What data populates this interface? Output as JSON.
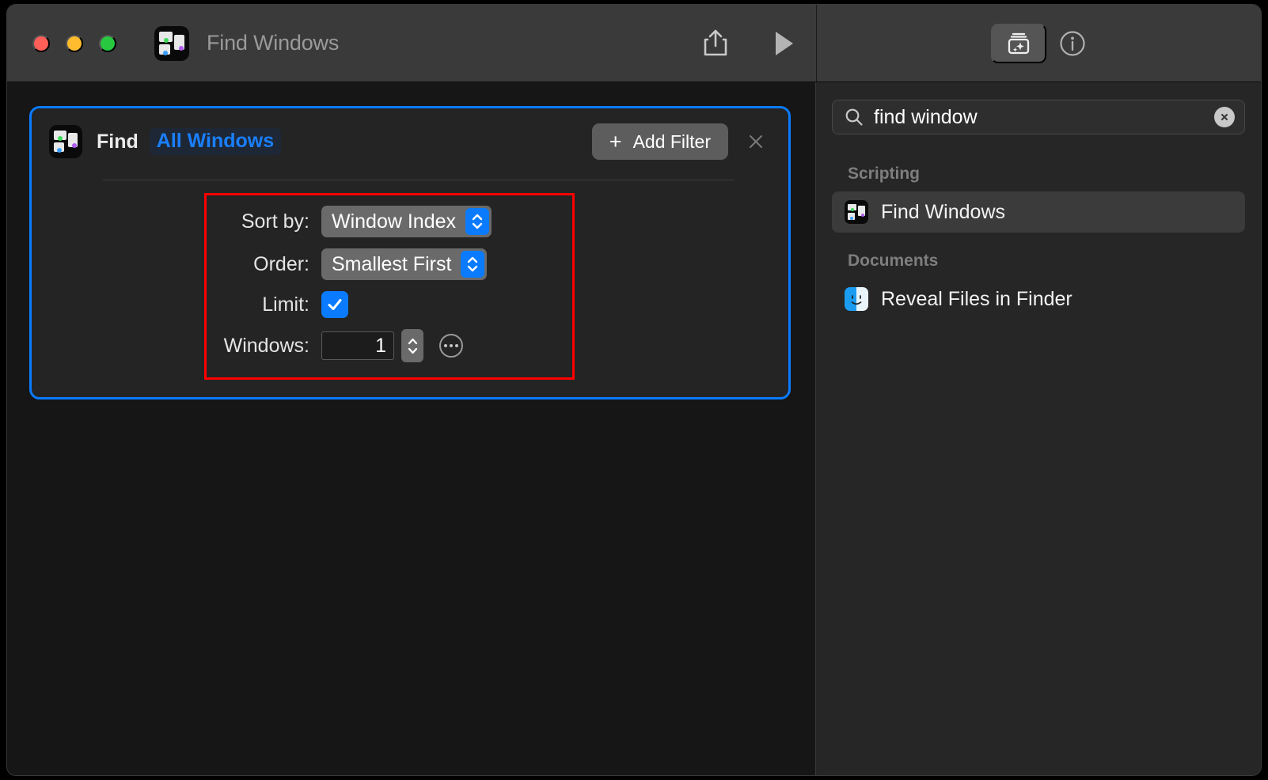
{
  "window": {
    "title": "Find Windows",
    "app_icon_name": "shortcuts-find-windows-icon"
  },
  "toolbar": {
    "share_label": "Share",
    "run_label": "Run",
    "library_label": "Action Library",
    "info_label": "Info"
  },
  "action_card": {
    "title": "Find",
    "token": "All Windows",
    "add_filter_label": "Add Filter",
    "add_filter_plus": "+",
    "close_label": "✕",
    "fields": [
      {
        "label": "Sort by:",
        "value": "Window Index",
        "type": "popup"
      },
      {
        "label": "Order:",
        "value": "Smallest First",
        "type": "popup"
      },
      {
        "label": "Limit:",
        "value": "checked",
        "type": "checkbox"
      },
      {
        "label": "Windows:",
        "value": "1",
        "type": "stepper"
      }
    ]
  },
  "sidebar": {
    "search": {
      "value": "find window",
      "placeholder": "Search",
      "clear_label": "✕"
    },
    "groups": [
      {
        "name": "Scripting",
        "items": [
          {
            "label": "Find Windows",
            "icon": "shortcuts-find-windows-icon",
            "selected": true
          }
        ]
      },
      {
        "name": "Documents",
        "items": [
          {
            "label": "Reveal Files in Finder",
            "icon": "finder-icon",
            "selected": false
          }
        ]
      }
    ]
  },
  "colors": {
    "accent_blue": "#0a7bff",
    "annotation_red": "#ff0000",
    "window_bg": "#161616",
    "card_bg": "#242424",
    "sidebar_bg": "#262626"
  }
}
